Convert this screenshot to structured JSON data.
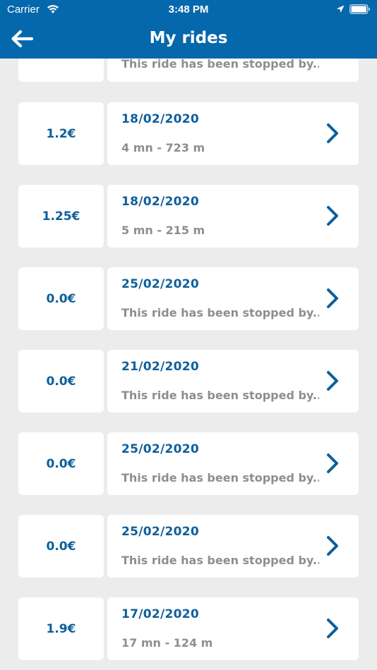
{
  "status_bar": {
    "carrier": "Carrier",
    "time": "3:48 PM"
  },
  "header": {
    "title": "My rides",
    "back_icon": "arrow-left-icon"
  },
  "colors": {
    "header": "#0568ac",
    "accent": "#0d5f9a",
    "muted_text": "#8e8e8e",
    "background": "#ececec"
  },
  "rides": [
    {
      "price": "",
      "date": "",
      "info": "This ride has been stopped by..."
    },
    {
      "price": "1.2€",
      "date": "18/02/2020",
      "info": "4 mn - 723 m"
    },
    {
      "price": "1.25€",
      "date": "18/02/2020",
      "info": "5 mn - 215 m"
    },
    {
      "price": "0.0€",
      "date": "25/02/2020",
      "info": "This ride has been stopped by..."
    },
    {
      "price": "0.0€",
      "date": "21/02/2020",
      "info": "This ride has been stopped by..."
    },
    {
      "price": "0.0€",
      "date": "25/02/2020",
      "info": "This ride has been stopped by..."
    },
    {
      "price": "0.0€",
      "date": "25/02/2020",
      "info": "This ride has been stopped by..."
    },
    {
      "price": "1.9€",
      "date": "17/02/2020",
      "info": "17 mn - 124 m"
    }
  ]
}
